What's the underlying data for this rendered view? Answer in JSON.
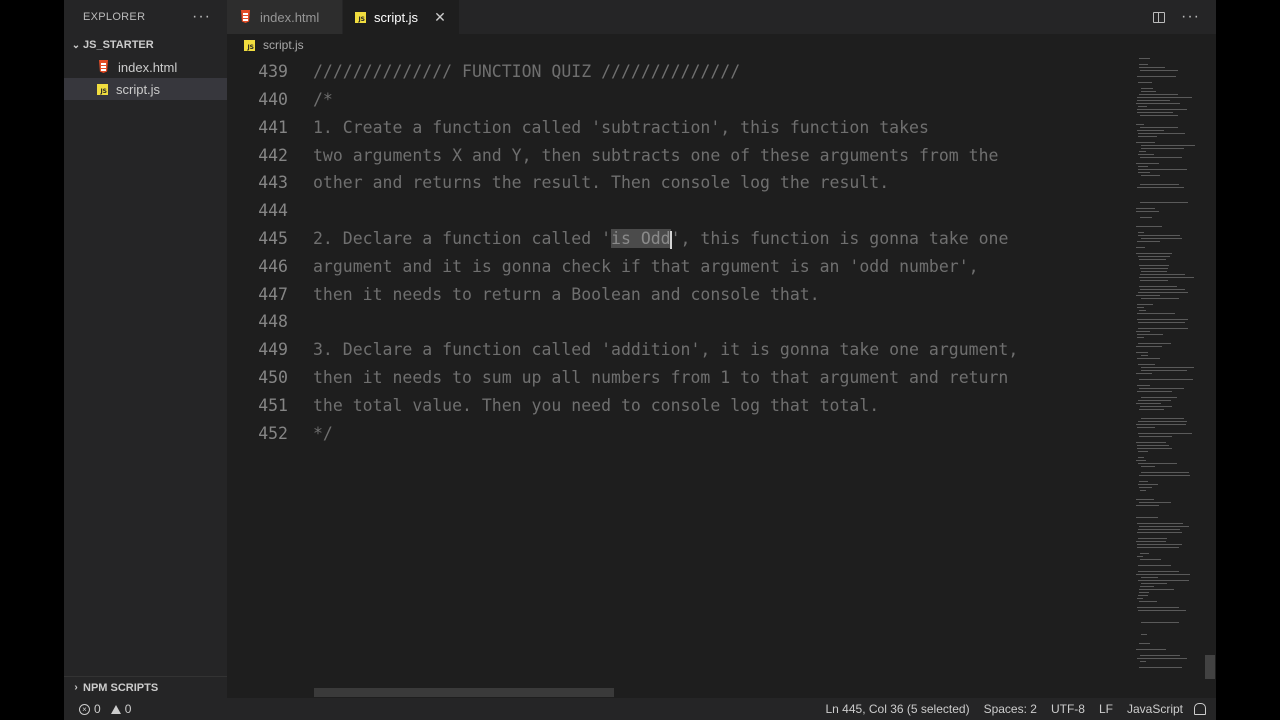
{
  "sidebar": {
    "title": "EXPLORER",
    "more": "···",
    "folder": "JS_STARTER",
    "files": [
      {
        "name": "index.html",
        "icon": "html-file-icon"
      },
      {
        "name": "script.js",
        "icon": "js-file-icon"
      }
    ],
    "npm_scripts": "NPM SCRIPTS"
  },
  "tabs": [
    {
      "label": "index.html",
      "icon": "html-file-icon",
      "active": false
    },
    {
      "label": "script.js",
      "icon": "js-file-icon",
      "active": true,
      "close": "✕"
    }
  ],
  "tab_actions": {
    "more": "···"
  },
  "breadcrumb": {
    "file": "script.js"
  },
  "editor": {
    "lines": [
      {
        "num": "439",
        "text": "////////////// FUNCTION QUIZ //////////////"
      },
      {
        "num": "440",
        "text": "/*"
      },
      {
        "num": "441",
        "text": "1. Create a function called 'subtraction', this function takes"
      },
      {
        "num": "442",
        "text": "two arguments X and Y, then subtracts one of these arguments from the"
      },
      {
        "num": "443",
        "text": "other and returns the result. Then console log the result."
      },
      {
        "num": "444",
        "text": ""
      },
      {
        "num": "445",
        "text_before": "2. Declare a function called '",
        "text_selected": "is Odd",
        "text_after": "', this function is gonna take one"
      },
      {
        "num": "446",
        "text": "argument and it is gonna check if that argument is an 'odd number',"
      },
      {
        "num": "447",
        "text": "then it needs to return a Boolean and console that."
      },
      {
        "num": "448",
        "text": ""
      },
      {
        "num": "449",
        "text": "3. Declare a function called 'addition', it is gonna take one argument,"
      },
      {
        "num": "450",
        "text": "then it needs to sum up all numbers from 1 to that argument and return"
      },
      {
        "num": "451",
        "text": "the total value. Then you need to console log that total."
      },
      {
        "num": "452",
        "text": "*/"
      }
    ]
  },
  "status": {
    "errors": "0",
    "warnings": "0",
    "position": "Ln 445, Col 36 (5 selected)",
    "spaces": "Spaces: 2",
    "encoding": "UTF-8",
    "eol": "LF",
    "language": "JavaScript"
  }
}
